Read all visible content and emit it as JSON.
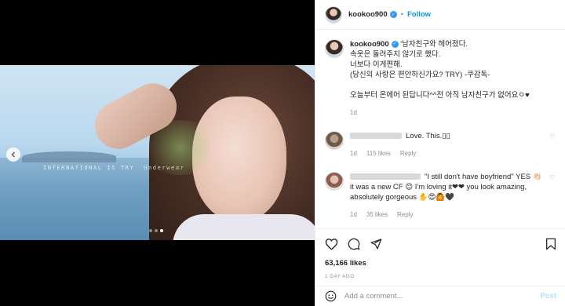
{
  "header": {
    "username": "kookoo900",
    "separator": "•",
    "follow_label": "Follow"
  },
  "media": {
    "watermark": "INTERNATIONAL IS TRY",
    "watermark_tail": "Underwear",
    "carousel": {
      "total": 3,
      "active_index": 2
    },
    "prev_icon": "chevron-left-icon"
  },
  "caption": {
    "username": "kookoo900",
    "text": "'남자친구와 헤어졌다.\n속옷은 돌려주지 않기로 했다.\n너보다 이게편해.\n(당신의 사랑은 편안하신가요? TRY) -쿠감독-\n\n오늘부터 온에어 된답니다^^전 아직 남자친구가 없어요ㅇ♥",
    "time": "1d"
  },
  "comments": [
    {
      "text": "Love. This.▯▯",
      "time": "1d",
      "likes": "115 likes",
      "reply": "Reply"
    },
    {
      "text": "\"I still don't have boyfriend\" YES 👏🏻 it was a new CF 😊 I'm loving it❤❤ you look amazing, absolutely gorgeous ✋😍🙆🖤",
      "time": "1d",
      "likes": "35 likes",
      "reply": "Reply"
    }
  ],
  "actions": {
    "likes": "63,166 likes",
    "time_ago": "1 DAY AGO"
  },
  "add_comment": {
    "placeholder": "Add a comment...",
    "post_label": "Post"
  },
  "colors": {
    "accent": "#0095f6",
    "verified": "#3897f0",
    "muted": "#8e8e8e"
  }
}
